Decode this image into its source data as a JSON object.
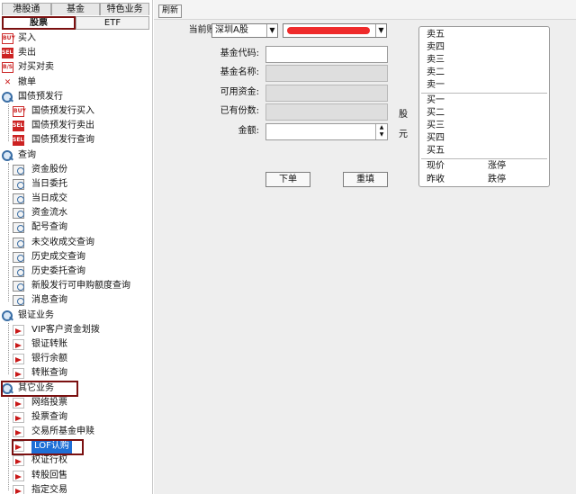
{
  "left": {
    "top_tabs": [
      "港股通",
      "基金",
      "特色业务"
    ],
    "bottom_tabs": [
      "股票",
      "ETF"
    ],
    "tree": [
      {
        "level": 1,
        "icon": "buy-icon",
        "label": "买入"
      },
      {
        "level": 1,
        "icon": "sell-icon",
        "label": "卖出"
      },
      {
        "level": 1,
        "icon": "buy-sell-icon",
        "label": "对买对卖"
      },
      {
        "level": 1,
        "icon": "cancel-icon",
        "label": "撤单"
      },
      {
        "level": 1,
        "icon": "magnifier-icon",
        "label": "国债预发行"
      },
      {
        "level": 2,
        "icon": "buy-icon",
        "label": "国债预发行买入"
      },
      {
        "level": 2,
        "icon": "sell-icon",
        "label": "国债预发行卖出"
      },
      {
        "level": 2,
        "icon": "sell-icon",
        "label": "国债预发行查询"
      },
      {
        "level": 1,
        "icon": "magnifier-icon",
        "label": "查询"
      },
      {
        "level": 2,
        "icon": "document-search-icon",
        "label": "资金股份"
      },
      {
        "level": 2,
        "icon": "document-search-icon",
        "label": "当日委托"
      },
      {
        "level": 2,
        "icon": "document-search-icon",
        "label": "当日成交"
      },
      {
        "level": 2,
        "icon": "document-search-icon",
        "label": "资金流水"
      },
      {
        "level": 2,
        "icon": "document-search-icon",
        "label": "配号查询"
      },
      {
        "level": 2,
        "icon": "document-search-icon",
        "label": "未交收成交查询"
      },
      {
        "level": 2,
        "icon": "document-search-icon",
        "label": "历史成交查询"
      },
      {
        "level": 2,
        "icon": "document-search-icon",
        "label": "历史委托查询"
      },
      {
        "level": 2,
        "icon": "document-search-icon",
        "label": "新股发行可申购额度查询"
      },
      {
        "level": 2,
        "icon": "document-search-icon",
        "label": "消息查询"
      },
      {
        "level": 1,
        "icon": "magnifier-icon",
        "label": "银证业务"
      },
      {
        "level": 2,
        "icon": "arrow-icon",
        "label": "VIP客户资金划拨"
      },
      {
        "level": 2,
        "icon": "arrow-icon",
        "label": "银证转账"
      },
      {
        "level": 2,
        "icon": "arrow-icon",
        "label": "银行余额"
      },
      {
        "level": 2,
        "icon": "arrow-icon",
        "label": "转账查询"
      },
      {
        "level": 1,
        "icon": "magnifier-icon",
        "label": "其它业务"
      },
      {
        "level": 2,
        "icon": "arrow-icon",
        "label": "网络投票"
      },
      {
        "level": 2,
        "icon": "arrow-icon",
        "label": "投票查询"
      },
      {
        "level": 2,
        "icon": "arrow-icon",
        "label": "交易所基金申赎"
      },
      {
        "level": 2,
        "icon": "arrow-icon",
        "label": "LOF认购"
      },
      {
        "level": 2,
        "icon": "arrow-icon",
        "label": "权证行权"
      },
      {
        "level": 2,
        "icon": "arrow-icon",
        "label": "转股回售"
      },
      {
        "level": 2,
        "icon": "arrow-icon",
        "label": "指定交易"
      }
    ]
  },
  "right": {
    "refresh_label": "刷新",
    "account_label": "当前账号:",
    "account_market": "深圳A股",
    "form": {
      "code_label": "基金代码:",
      "name_label": "基金名称:",
      "available_label": "可用资金:",
      "holdings_label": "已有份数:",
      "holdings_unit": "股",
      "amount_label": "金额:",
      "amount_unit": "元"
    },
    "buttons": {
      "submit": "下单",
      "reset": "重填"
    },
    "quote": {
      "sell_levels": [
        "卖五",
        "卖四",
        "卖三",
        "卖二",
        "卖一"
      ],
      "buy_levels": [
        "买一",
        "买二",
        "买三",
        "买四",
        "买五"
      ],
      "current_price_label": "现价",
      "limit_up_label": "涨停",
      "prev_close_label": "昨收",
      "limit_down_label": "跌停"
    }
  },
  "colors": {
    "highlight_border": "#7b1010",
    "selection": "#1e6fd6",
    "redacted": "#ef2b2b"
  }
}
